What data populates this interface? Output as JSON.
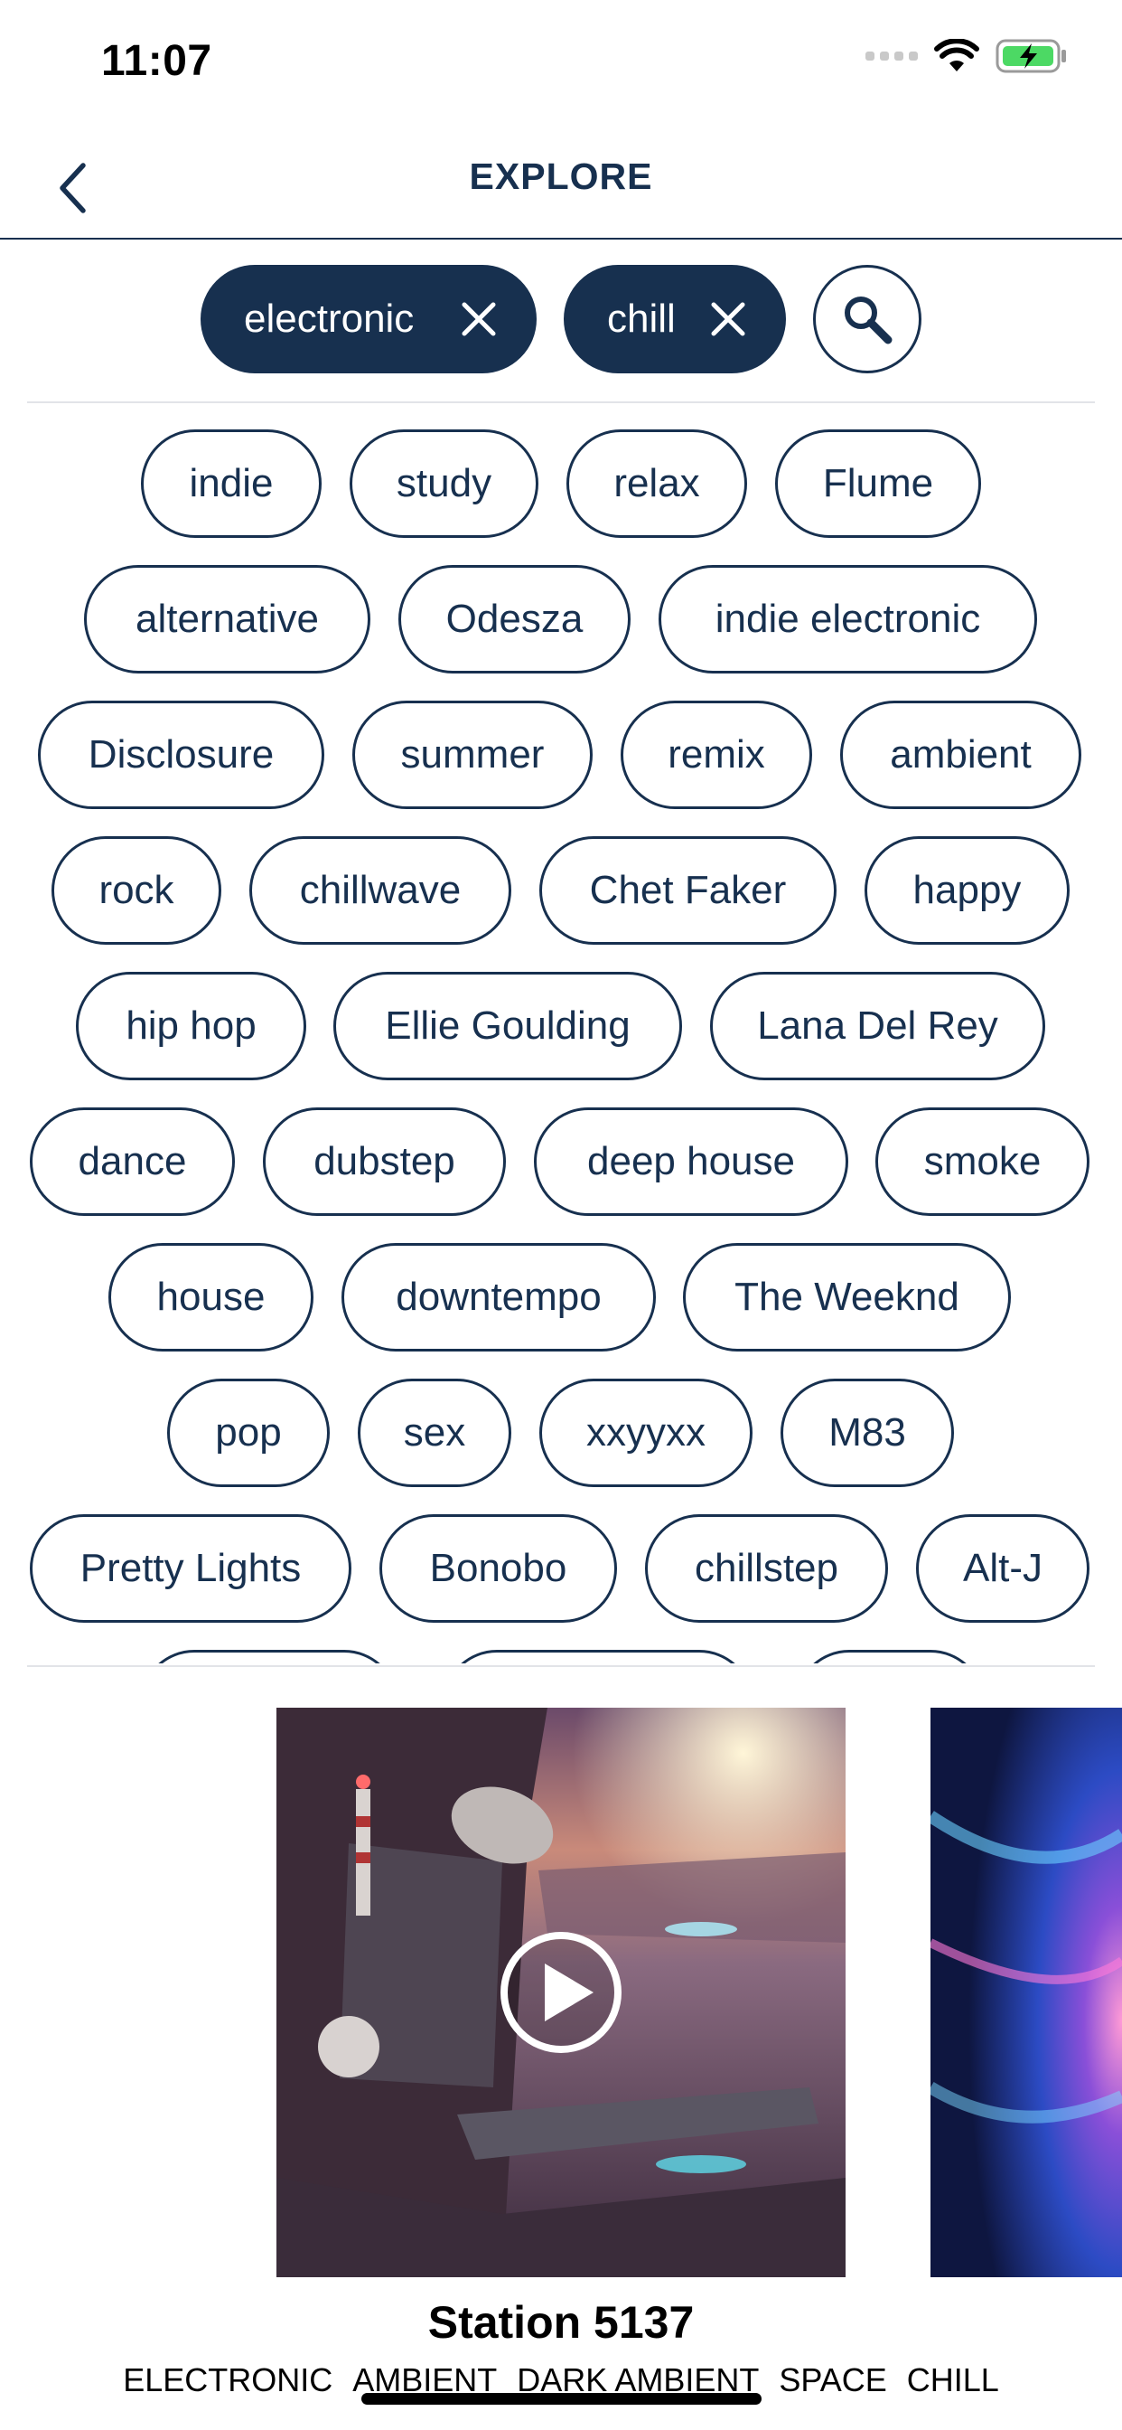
{
  "status_bar": {
    "time": "11:07"
  },
  "header": {
    "title": "EXPLORE"
  },
  "selected_tags": [
    "electronic",
    "chill"
  ],
  "tag_rows": [
    [
      "indie",
      "study",
      "relax",
      "Flume"
    ],
    [
      "alternative",
      "Odesza",
      "indie electronic"
    ],
    [
      "Disclosure",
      "summer",
      "remix",
      "ambient"
    ],
    [
      "rock",
      "chillwave",
      "Chet Faker",
      "happy"
    ],
    [
      "hip hop",
      "Ellie Goulding",
      "Lana Del Rey"
    ],
    [
      "dance",
      "dubstep",
      "deep house",
      "smoke"
    ],
    [
      "house",
      "downtempo",
      "The Weeknd"
    ],
    [
      "pop",
      "sex",
      "xxyyxx",
      "M83"
    ],
    [
      "Pretty Lights",
      "Bonobo",
      "chillstep",
      "Alt-J"
    ]
  ],
  "station": {
    "name": "Station 5137",
    "genres": [
      "ELECTRONIC",
      "AMBIENT",
      "DARK AMBIENT",
      "SPACE",
      "CHILL"
    ]
  },
  "colors": {
    "navy": "#17304f",
    "battery_green": "#4cd964"
  },
  "icons": [
    "signal-icon",
    "wifi-icon",
    "battery-charging-icon",
    "back-chevron-icon",
    "close-icon",
    "search-icon",
    "play-icon"
  ]
}
